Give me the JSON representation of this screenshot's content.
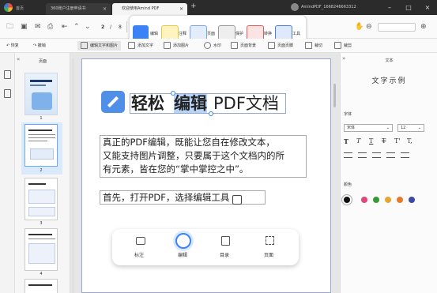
{
  "titlebar": {
    "tabs": [
      "首页",
      "360账户注册申请书",
      "欢迎使用Amind PDF"
    ],
    "account": "AmindPDF_1668246663312",
    "colors": {
      "bg": "#2b2b2b"
    }
  },
  "toolbar": {
    "page_current": "2",
    "page_total": "8",
    "ribbon": [
      "编辑",
      "注释",
      "页面",
      "保护",
      "转换",
      "工具"
    ],
    "zoom_value": ""
  },
  "edit_toolbar": {
    "undo": "恢复",
    "redo": "撤销",
    "items": [
      "编辑文字和图片",
      "添加文字",
      "添加图片",
      "水印",
      "页面背景",
      "页面页脚",
      "裁切",
      "裁剪"
    ]
  },
  "left_panel": {
    "title": "页面",
    "page_numbers": [
      "1",
      "2",
      "3",
      "4"
    ]
  },
  "document": {
    "heading_part1": "轻松",
    "heading_highlight": "编辑",
    "heading_part2": "PDF文档",
    "para1_line1": "真正的PDF编辑，既能让您自在修改文本，",
    "para1_line2": "又能支持图片调整，只要属于这个文档内的所",
    "para1_line3": "有元素，皆在您的“掌中掌控之中”。",
    "para2": "首先，打开PDF，选择编辑工具",
    "bottom_bar": [
      "标注",
      "编辑",
      "目录",
      "页面"
    ]
  },
  "right_panel": {
    "title": "文本",
    "sample": "文字示例",
    "font_label": "字体",
    "font_value": "宋体",
    "size_value": "12",
    "style_buttons": [
      "T",
      "T",
      "T",
      "T",
      "T'",
      "T,"
    ],
    "color_label": "颜色",
    "colors": [
      "#111111",
      "#e2457a",
      "#3a9a3a",
      "#e8a534",
      "#e77a2a",
      "#3a4aa8"
    ]
  }
}
